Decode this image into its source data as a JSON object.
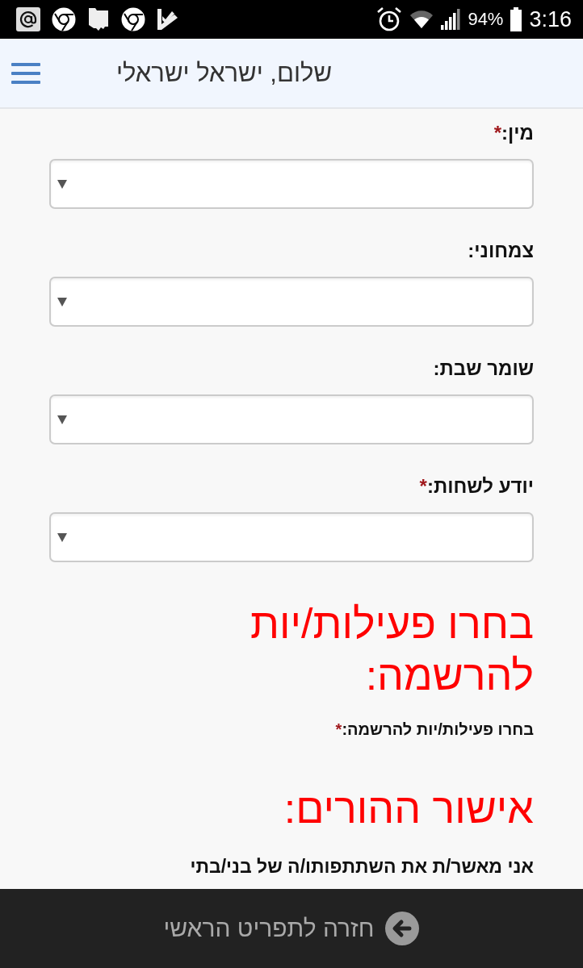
{
  "status_bar": {
    "battery": "94%",
    "time": "3:16"
  },
  "header": {
    "title": "שלום, ישראל ישראלי"
  },
  "fields": [
    {
      "label": "מין:",
      "required_mark": "*"
    },
    {
      "label": "צמחוני:"
    },
    {
      "label": "שומר שבת:"
    },
    {
      "label": "יודע לשחות:",
      "required_mark": "*"
    }
  ],
  "activities": {
    "heading": "בחרו פעילות/יות להרשמה:",
    "label": "בחרו פעילות/יות להרשמה:",
    "required_mark": "*"
  },
  "parents": {
    "heading": "אישור ההורים:",
    "text": "אני מאשר/ת את השתתפותו/ה של בני/בתי"
  },
  "bottom_bar": {
    "button": "חזרה לתפריט הראשי"
  }
}
